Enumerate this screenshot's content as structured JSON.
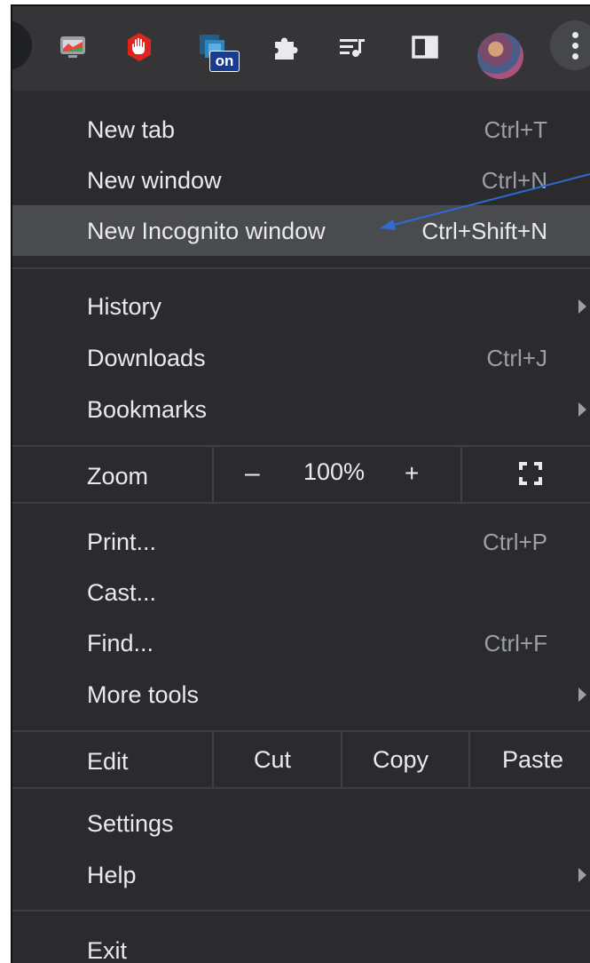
{
  "colors": {
    "menu_bg": "#2b2b2d",
    "toolbar_bg": "#353538",
    "highlight_bg": "#4a4b4e",
    "text": "#e8eaed",
    "accel_text": "#9aa0a6",
    "annotation_arrow": "#2f6bd6"
  },
  "toolbar": {
    "icons": [
      "chrome-remote-desktop-icon",
      "ad-block-hand-icon",
      "extension-on-badge-icon",
      "extensions-puzzle-icon",
      "reading-list-icon",
      "side-panel-icon",
      "profile-avatar",
      "more-menu-icon"
    ],
    "badge_text": "on"
  },
  "menu": {
    "section1": [
      {
        "label": "New tab",
        "accel": "Ctrl+T"
      },
      {
        "label": "New window",
        "accel": "Ctrl+N"
      },
      {
        "label": "New Incognito window",
        "accel": "Ctrl+Shift+N",
        "highlighted": true
      }
    ],
    "section2": [
      {
        "label": "History",
        "submenu": true
      },
      {
        "label": "Downloads",
        "accel": "Ctrl+J"
      },
      {
        "label": "Bookmarks",
        "submenu": true
      }
    ],
    "zoom": {
      "label": "Zoom",
      "minus": "–",
      "value": "100%",
      "plus": "+",
      "fullscreen_icon": "fullscreen-icon"
    },
    "section3": [
      {
        "label": "Print...",
        "accel": "Ctrl+P"
      },
      {
        "label": "Cast..."
      },
      {
        "label": "Find...",
        "accel": "Ctrl+F"
      },
      {
        "label": "More tools",
        "submenu": true
      }
    ],
    "edit": {
      "label": "Edit",
      "cut": "Cut",
      "copy": "Copy",
      "paste": "Paste"
    },
    "section4": [
      {
        "label": "Settings"
      },
      {
        "label": "Help",
        "submenu": true
      }
    ],
    "exit": {
      "label": "Exit"
    }
  }
}
